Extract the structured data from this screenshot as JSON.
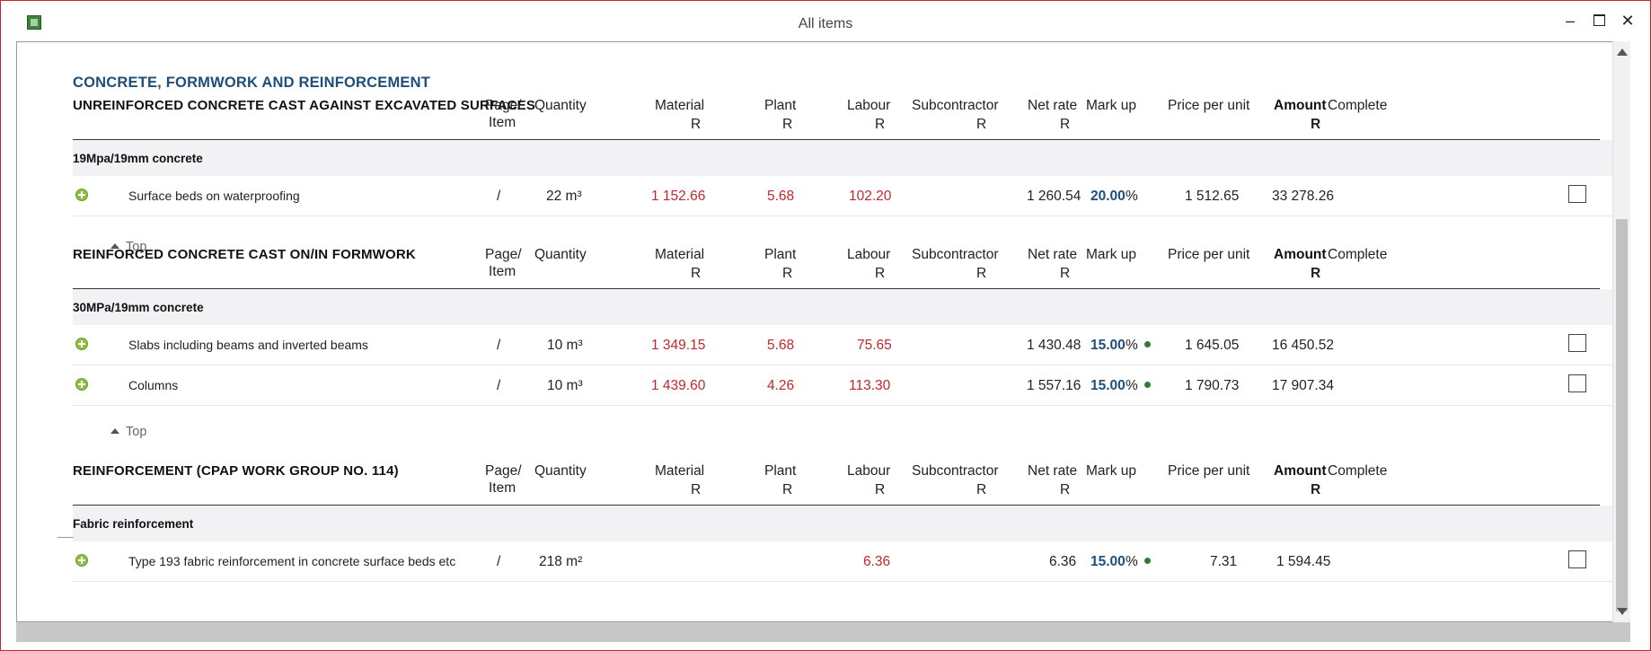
{
  "window": {
    "title": "All items"
  },
  "page": {
    "heading": "CONCRETE, FORMWORK AND REINFORCEMENT",
    "top_label": "Top"
  },
  "columns": {
    "page_item_1": "Page/",
    "page_item_2": "Item",
    "quantity": "Quantity",
    "material": "Material",
    "plant": "Plant",
    "labour": "Labour",
    "subcontractor": "Subcontractor",
    "net_rate": "Net rate",
    "mark_up": "Mark up",
    "price_per_unit": "Price per unit",
    "amount": "Amount",
    "complete": "Complete",
    "currency": "R"
  },
  "sections": [
    {
      "title": "UNREINFORCED CONCRETE CAST AGAINST EXCAVATED SURFACES",
      "group": "19Mpa/19mm concrete",
      "rows": [
        {
          "description": "Surface beds on waterproofing",
          "page_item": "/",
          "quantity": "22 m³",
          "material": "1 152.66",
          "plant": "5.68",
          "labour": "102.20",
          "subcontractor": "",
          "net_rate": "1 260.54",
          "mark_up": "20.00",
          "pct": "%",
          "price_per_unit": "1 512.65",
          "amount": "33 278.26",
          "complete": false
        }
      ]
    },
    {
      "title": "REINFORCED CONCRETE CAST ON/IN FORMWORK",
      "group": "30MPa/19mm concrete",
      "rows": [
        {
          "description": "Slabs including beams and inverted beams",
          "page_item": "/",
          "quantity": "10 m³",
          "material": "1 349.15",
          "plant": "5.68",
          "labour": "75.65",
          "subcontractor": "",
          "net_rate": "1 430.48",
          "mark_up": "15.00",
          "pct": "%",
          "price_per_unit": "1 645.05",
          "amount": "16 450.52",
          "complete": false
        },
        {
          "description": "Columns",
          "page_item": "/",
          "quantity": "10 m³",
          "material": "1 439.60",
          "plant": "4.26",
          "labour": "113.30",
          "subcontractor": "",
          "net_rate": "1 557.16",
          "mark_up": "15.00",
          "pct": "%",
          "price_per_unit": "1 790.73",
          "amount": "17 907.34",
          "complete": false
        }
      ]
    },
    {
      "title": "REINFORCEMENT (CPAP WORK GROUP NO. 114)",
      "group": "Fabric reinforcement",
      "rows": [
        {
          "description": "Type 193 fabric reinforcement in concrete surface beds etc",
          "page_item": "/",
          "quantity": "218 m²",
          "material": "",
          "plant": "",
          "labour": "6.36",
          "subcontractor": "",
          "net_rate": "6.36",
          "mark_up": "15.00",
          "pct": "%",
          "price_per_unit": "7.31",
          "amount": "1 594.45",
          "complete": false
        }
      ]
    }
  ],
  "colors": {
    "heading": "#1f4e79",
    "cost_red": "#c0282d",
    "markup_blue": "#1f4e79",
    "indicator_green": "#2e7d32",
    "expand_green": "#8fbf3f",
    "window_border": "#c8242f"
  },
  "icons": {
    "expand": "plus-circle-icon",
    "indicator": "green-dot-icon",
    "top": "triangle-up-icon"
  }
}
